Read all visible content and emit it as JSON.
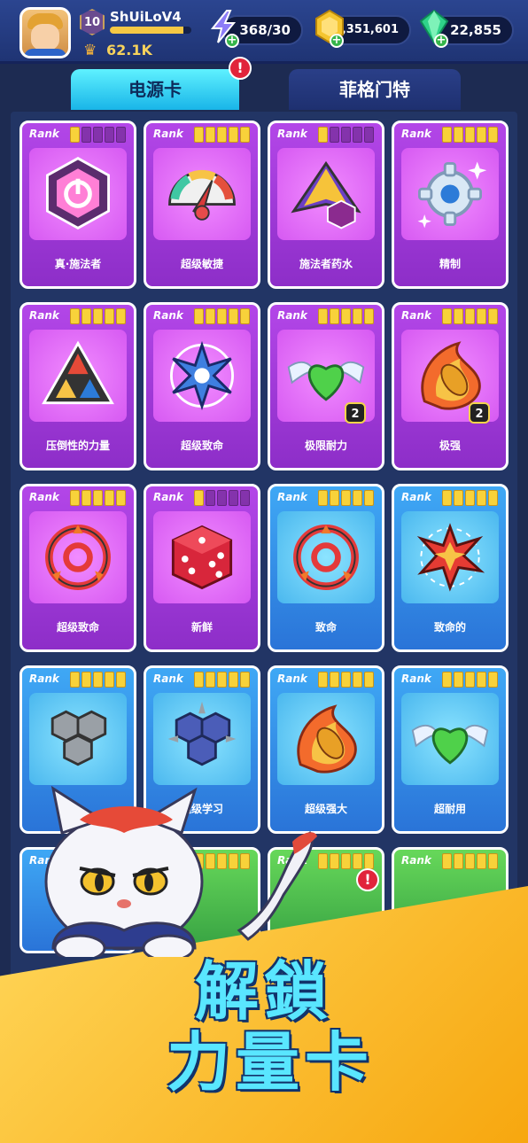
{
  "player": {
    "name": "ShUiLoV4",
    "level": "10",
    "trophies": "62.1K",
    "xp_fraction": 0.9
  },
  "resources": {
    "energy": "368/30",
    "gold": "1,351,601",
    "gems": "22,855"
  },
  "tabs": {
    "active": "电源卡",
    "inactive": "菲格门特"
  },
  "icons": {
    "alert": "!",
    "plus": "+",
    "trophy": "♛"
  },
  "rank_label": "Rank",
  "cards": [
    {
      "name": "真·施法者",
      "color": "purple",
      "rank": 1,
      "icon": "power-hexagon-icon"
    },
    {
      "name": "超级敏捷",
      "color": "purple",
      "rank": 5,
      "icon": "speed-gauge-icon"
    },
    {
      "name": "施法者药水",
      "color": "purple",
      "rank": 1,
      "icon": "potion-gem-icon"
    },
    {
      "name": "精制",
      "color": "purple",
      "rank": 5,
      "icon": "gear-icon"
    },
    {
      "name": "压倒性的力量",
      "color": "purple",
      "rank": 5,
      "icon": "triangle-gems-icon"
    },
    {
      "name": "超级致命",
      "color": "purple",
      "rank": 5,
      "icon": "lightning-burst-icon"
    },
    {
      "name": "极限耐力",
      "color": "purple",
      "rank": 5,
      "icon": "winged-heart-icon",
      "count": "2"
    },
    {
      "name": "极强",
      "color": "purple",
      "rank": 5,
      "icon": "fire-bullet-icon",
      "count": "2"
    },
    {
      "name": "超级致命",
      "color": "purple",
      "rank": 5,
      "icon": "target-icon"
    },
    {
      "name": "新鲜",
      "color": "purple",
      "rank": 1,
      "icon": "dice-icon"
    },
    {
      "name": "致命",
      "color": "blue",
      "rank": 5,
      "icon": "target-icon"
    },
    {
      "name": "致命的",
      "color": "blue",
      "rank": 5,
      "icon": "explosion-icon"
    },
    {
      "name": "",
      "color": "blue",
      "rank": 5,
      "icon": "hex-stone-icon"
    },
    {
      "name": "超级学习",
      "color": "blue",
      "rank": 5,
      "icon": "spiked-hex-icon"
    },
    {
      "name": "超级强大",
      "color": "blue",
      "rank": 5,
      "icon": "fire-bullet-icon"
    },
    {
      "name": "超耐用",
      "color": "blue",
      "rank": 5,
      "icon": "winged-heart-icon"
    }
  ],
  "bottom_cards": [
    {
      "color": "blue",
      "rank": 5
    },
    {
      "color": "green",
      "rank": 5
    },
    {
      "color": "green",
      "rank": 5
    },
    {
      "color": "green",
      "rank": 5
    }
  ],
  "promo": {
    "line1": "解鎖",
    "line2": "力量卡"
  },
  "colors": {
    "purple_card": "#b346e8",
    "blue_card": "#3fa8f5",
    "green_card": "#67d85a",
    "promo_text": "#59e6ff",
    "promo_bg": "#ffd75a"
  }
}
